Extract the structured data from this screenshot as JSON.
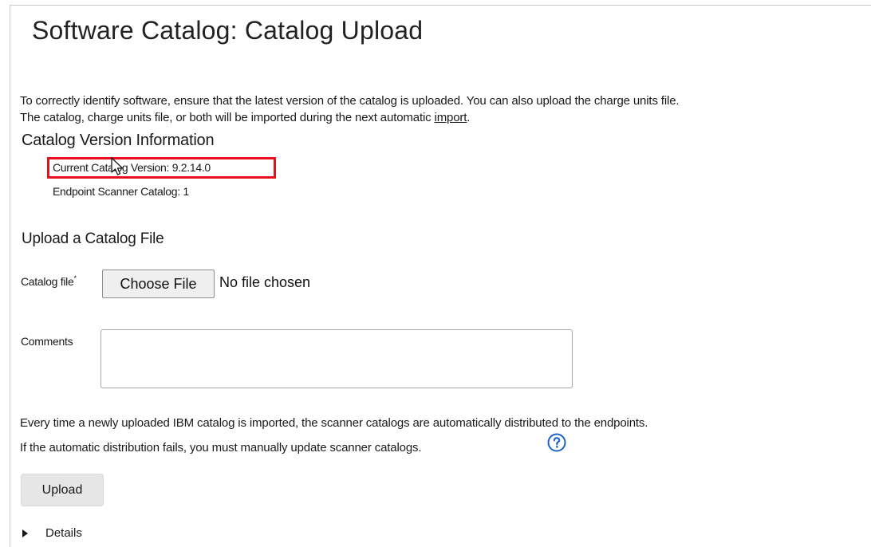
{
  "page": {
    "title": "Software Catalog: Catalog Upload"
  },
  "intro": {
    "line1": "To correctly identify software, ensure that the latest version of the catalog is uploaded. You can also upload the charge units file.",
    "line2_prefix": "The catalog, charge units file, or both will be imported during the next automatic ",
    "import_link": "import",
    "line2_suffix": "."
  },
  "version_info": {
    "heading": "Catalog Version Information",
    "current_catalog": "Current Catalog Version: 9.2.14.0",
    "endpoint_scanner": "Endpoint Scanner Catalog: 1"
  },
  "upload_section": {
    "heading": "Upload a Catalog File",
    "catalog_file_label": "Catalog file",
    "required_marker": "*",
    "choose_file_button": "Choose File",
    "no_file_text": "No file chosen",
    "comments_label": "Comments",
    "comments_value": ""
  },
  "distribution": {
    "line1": "Every time a newly uploaded IBM catalog is imported, the scanner catalogs are automatically distributed to the endpoints.",
    "line2": "If the automatic distribution fails, you must manually update scanner catalogs."
  },
  "actions": {
    "upload_button": "Upload",
    "details_label": "Details"
  },
  "icons": {
    "help": "help-icon",
    "cursor": "mouse-pointer-icon",
    "details": "triangle-right-icon"
  },
  "colors": {
    "highlight": "#e8101c",
    "help_blue": "#1c64c8",
    "button_bg": "#e6e6e6"
  }
}
